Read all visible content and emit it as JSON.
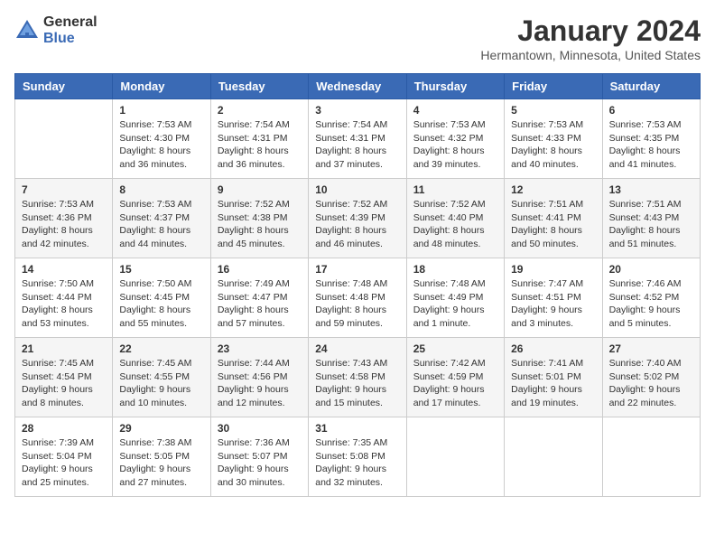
{
  "header": {
    "logo_general": "General",
    "logo_blue": "Blue",
    "month_title": "January 2024",
    "location": "Hermantown, Minnesota, United States"
  },
  "weekdays": [
    "Sunday",
    "Monday",
    "Tuesday",
    "Wednesday",
    "Thursday",
    "Friday",
    "Saturday"
  ],
  "weeks": [
    [
      {
        "day": "",
        "info": ""
      },
      {
        "day": "1",
        "info": "Sunrise: 7:53 AM\nSunset: 4:30 PM\nDaylight: 8 hours\nand 36 minutes."
      },
      {
        "day": "2",
        "info": "Sunrise: 7:54 AM\nSunset: 4:31 PM\nDaylight: 8 hours\nand 36 minutes."
      },
      {
        "day": "3",
        "info": "Sunrise: 7:54 AM\nSunset: 4:31 PM\nDaylight: 8 hours\nand 37 minutes."
      },
      {
        "day": "4",
        "info": "Sunrise: 7:53 AM\nSunset: 4:32 PM\nDaylight: 8 hours\nand 39 minutes."
      },
      {
        "day": "5",
        "info": "Sunrise: 7:53 AM\nSunset: 4:33 PM\nDaylight: 8 hours\nand 40 minutes."
      },
      {
        "day": "6",
        "info": "Sunrise: 7:53 AM\nSunset: 4:35 PM\nDaylight: 8 hours\nand 41 minutes."
      }
    ],
    [
      {
        "day": "7",
        "info": "Sunrise: 7:53 AM\nSunset: 4:36 PM\nDaylight: 8 hours\nand 42 minutes."
      },
      {
        "day": "8",
        "info": "Sunrise: 7:53 AM\nSunset: 4:37 PM\nDaylight: 8 hours\nand 44 minutes."
      },
      {
        "day": "9",
        "info": "Sunrise: 7:52 AM\nSunset: 4:38 PM\nDaylight: 8 hours\nand 45 minutes."
      },
      {
        "day": "10",
        "info": "Sunrise: 7:52 AM\nSunset: 4:39 PM\nDaylight: 8 hours\nand 46 minutes."
      },
      {
        "day": "11",
        "info": "Sunrise: 7:52 AM\nSunset: 4:40 PM\nDaylight: 8 hours\nand 48 minutes."
      },
      {
        "day": "12",
        "info": "Sunrise: 7:51 AM\nSunset: 4:41 PM\nDaylight: 8 hours\nand 50 minutes."
      },
      {
        "day": "13",
        "info": "Sunrise: 7:51 AM\nSunset: 4:43 PM\nDaylight: 8 hours\nand 51 minutes."
      }
    ],
    [
      {
        "day": "14",
        "info": "Sunrise: 7:50 AM\nSunset: 4:44 PM\nDaylight: 8 hours\nand 53 minutes."
      },
      {
        "day": "15",
        "info": "Sunrise: 7:50 AM\nSunset: 4:45 PM\nDaylight: 8 hours\nand 55 minutes."
      },
      {
        "day": "16",
        "info": "Sunrise: 7:49 AM\nSunset: 4:47 PM\nDaylight: 8 hours\nand 57 minutes."
      },
      {
        "day": "17",
        "info": "Sunrise: 7:48 AM\nSunset: 4:48 PM\nDaylight: 8 hours\nand 59 minutes."
      },
      {
        "day": "18",
        "info": "Sunrise: 7:48 AM\nSunset: 4:49 PM\nDaylight: 9 hours\nand 1 minute."
      },
      {
        "day": "19",
        "info": "Sunrise: 7:47 AM\nSunset: 4:51 PM\nDaylight: 9 hours\nand 3 minutes."
      },
      {
        "day": "20",
        "info": "Sunrise: 7:46 AM\nSunset: 4:52 PM\nDaylight: 9 hours\nand 5 minutes."
      }
    ],
    [
      {
        "day": "21",
        "info": "Sunrise: 7:45 AM\nSunset: 4:54 PM\nDaylight: 9 hours\nand 8 minutes."
      },
      {
        "day": "22",
        "info": "Sunrise: 7:45 AM\nSunset: 4:55 PM\nDaylight: 9 hours\nand 10 minutes."
      },
      {
        "day": "23",
        "info": "Sunrise: 7:44 AM\nSunset: 4:56 PM\nDaylight: 9 hours\nand 12 minutes."
      },
      {
        "day": "24",
        "info": "Sunrise: 7:43 AM\nSunset: 4:58 PM\nDaylight: 9 hours\nand 15 minutes."
      },
      {
        "day": "25",
        "info": "Sunrise: 7:42 AM\nSunset: 4:59 PM\nDaylight: 9 hours\nand 17 minutes."
      },
      {
        "day": "26",
        "info": "Sunrise: 7:41 AM\nSunset: 5:01 PM\nDaylight: 9 hours\nand 19 minutes."
      },
      {
        "day": "27",
        "info": "Sunrise: 7:40 AM\nSunset: 5:02 PM\nDaylight: 9 hours\nand 22 minutes."
      }
    ],
    [
      {
        "day": "28",
        "info": "Sunrise: 7:39 AM\nSunset: 5:04 PM\nDaylight: 9 hours\nand 25 minutes."
      },
      {
        "day": "29",
        "info": "Sunrise: 7:38 AM\nSunset: 5:05 PM\nDaylight: 9 hours\nand 27 minutes."
      },
      {
        "day": "30",
        "info": "Sunrise: 7:36 AM\nSunset: 5:07 PM\nDaylight: 9 hours\nand 30 minutes."
      },
      {
        "day": "31",
        "info": "Sunrise: 7:35 AM\nSunset: 5:08 PM\nDaylight: 9 hours\nand 32 minutes."
      },
      {
        "day": "",
        "info": ""
      },
      {
        "day": "",
        "info": ""
      },
      {
        "day": "",
        "info": ""
      }
    ]
  ]
}
